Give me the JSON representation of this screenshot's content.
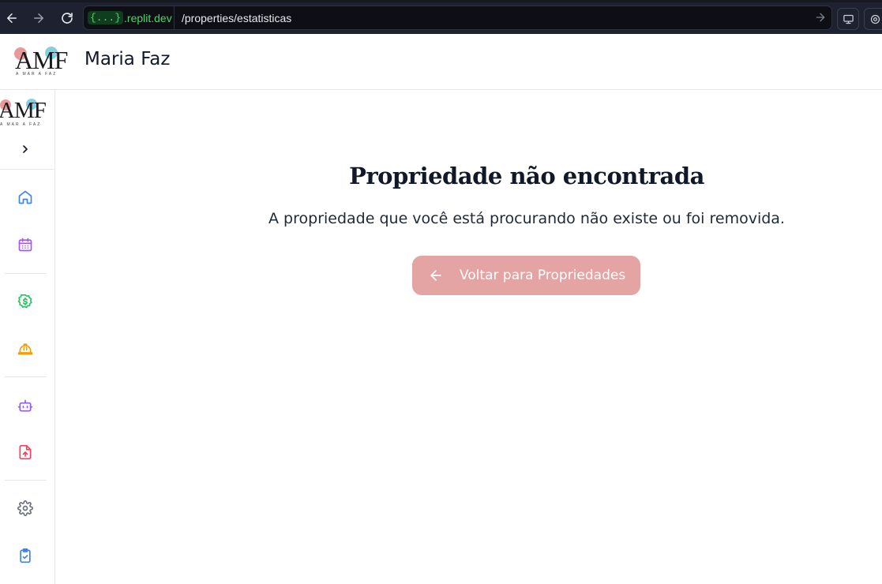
{
  "browser": {
    "host_prefix": "{...}",
    "host_domain": ".replit.dev",
    "path": "/properties/estatisticas"
  },
  "header": {
    "logo_text": "AMF",
    "logo_subtext": "A MAR A FAZ",
    "title": "Maria Faz"
  },
  "sidebar": {
    "logo_text": "AMF",
    "logo_subtext": "A MAR A FAZ",
    "items": [
      {
        "icon": "home-icon",
        "color": "#3b82f6"
      },
      {
        "icon": "calendar-icon",
        "color": "#a855f7"
      },
      {
        "icon": "dollar-badge-icon",
        "color": "#22c55e"
      },
      {
        "icon": "hard-hat-icon",
        "color": "#f59e0b"
      },
      {
        "icon": "bot-icon",
        "color": "#8b5cf6"
      },
      {
        "icon": "file-upload-icon",
        "color": "#f43f5e"
      },
      {
        "icon": "gear-icon",
        "color": "#6b7280"
      },
      {
        "icon": "clipboard-check-icon",
        "color": "#3b82f6"
      }
    ]
  },
  "main": {
    "title": "Propriedade não encontrada",
    "description": "A propriedade que você está procurando não existe ou foi removida.",
    "back_button_label": "Voltar para Propriedades"
  },
  "colors": {
    "browser_bg": "#1e2230",
    "back_button_bg": "#e5a4a4",
    "logo_dot_pink": "#e89a9a",
    "logo_dot_blue": "#86cfe0"
  }
}
